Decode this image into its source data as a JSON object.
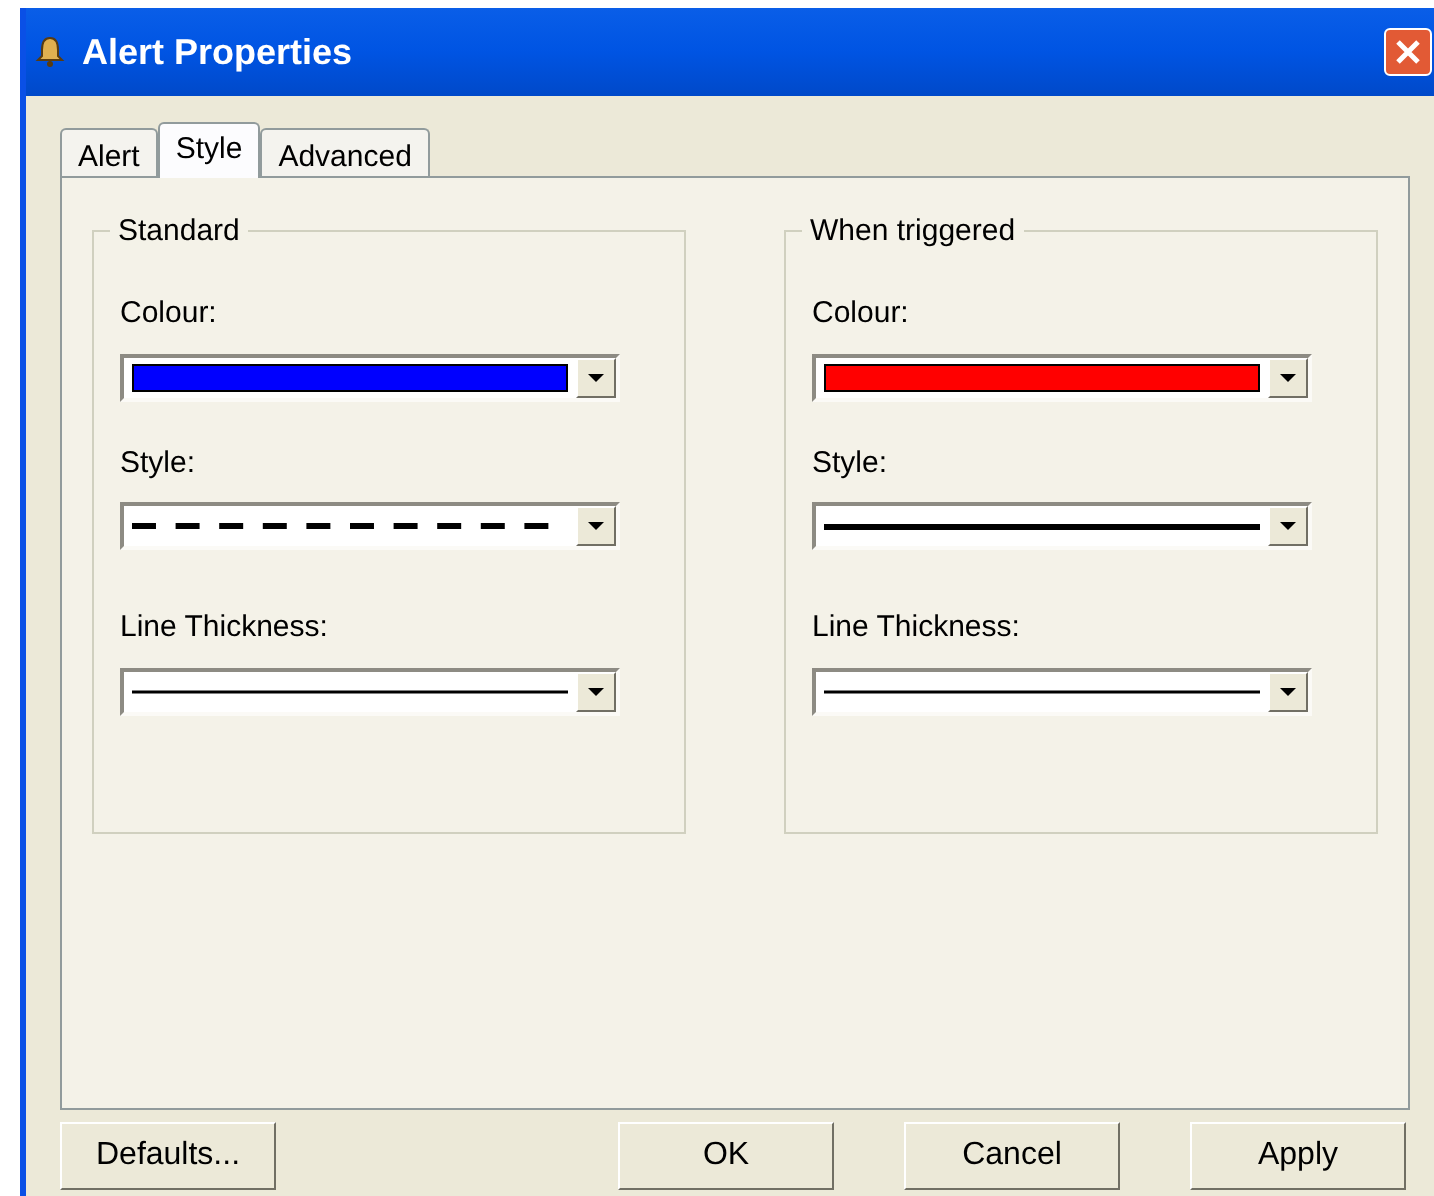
{
  "window": {
    "title": "Alert Properties"
  },
  "tabs": [
    {
      "label": "Alert",
      "selected": false
    },
    {
      "label": "Style",
      "selected": true
    },
    {
      "label": "Advanced",
      "selected": false
    }
  ],
  "groups": [
    {
      "title": "Standard",
      "fields": [
        {
          "label": "Colour:",
          "kind": "colour",
          "color": "#0000ff"
        },
        {
          "label": "Style:",
          "kind": "dashed-line"
        },
        {
          "label": "Line Thickness:",
          "kind": "thin-line"
        }
      ]
    },
    {
      "title": "When triggered",
      "fields": [
        {
          "label": "Colour:",
          "kind": "colour",
          "color": "#ff0000"
        },
        {
          "label": "Style:",
          "kind": "solid-line"
        },
        {
          "label": "Line Thickness:",
          "kind": "thin-line"
        }
      ]
    }
  ],
  "buttons": [
    "Defaults...",
    "OK",
    "Cancel",
    "Apply"
  ]
}
